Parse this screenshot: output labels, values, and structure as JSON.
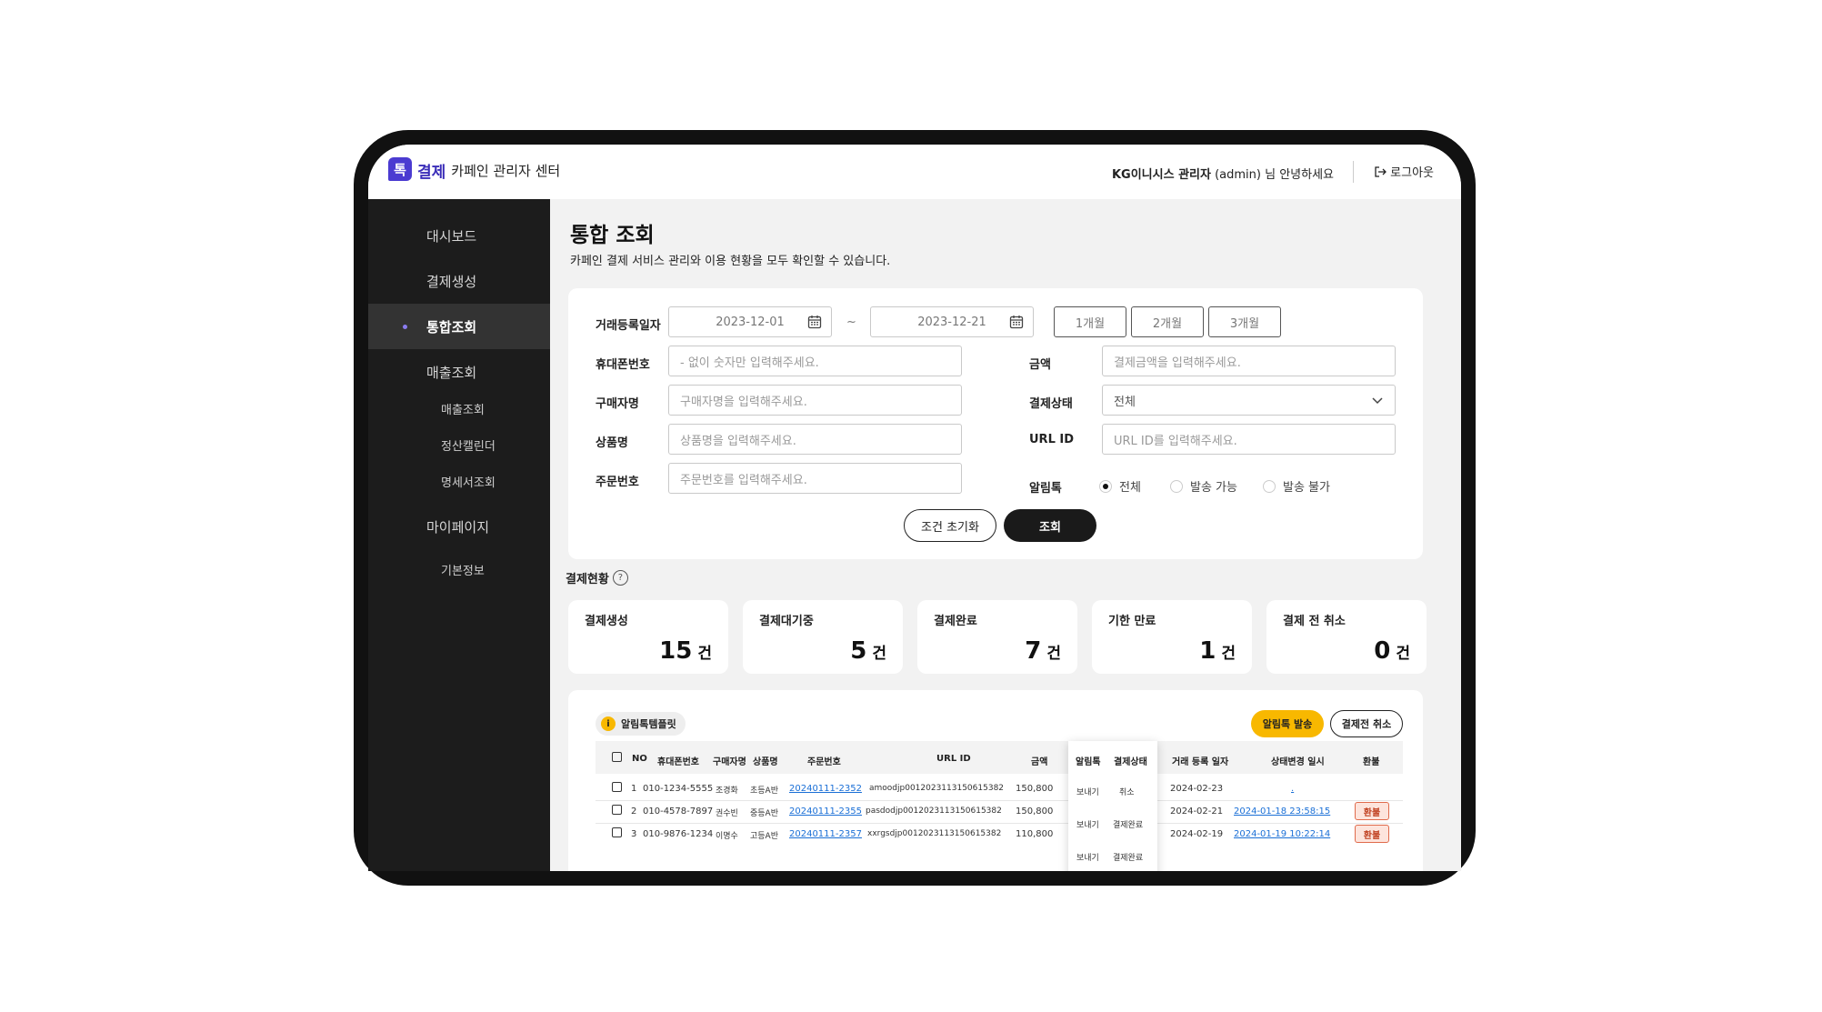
{
  "header": {
    "logo_mark": "톡",
    "logo_brand": "결제",
    "logo_sub": "카페인 관리자 센터",
    "greeting_user": "KG이니시스 관리자",
    "greeting_rest": "(admin) 님 안녕하세요",
    "logout": "로그아웃"
  },
  "sidebar": {
    "items": [
      {
        "label": "대시보드"
      },
      {
        "label": "결제생성"
      },
      {
        "label": "통합조회"
      },
      {
        "label": "매출조회"
      },
      {
        "label": "마이페이지"
      }
    ],
    "sub_sales": [
      "매출조회",
      "정산캘린더",
      "명세서조회"
    ],
    "sub_mypage": [
      "기본정보"
    ]
  },
  "page": {
    "title": "통합 조회",
    "desc": "카페인 결제 서비스 관리와 이용 현황을 모두 확인할 수 있습니다."
  },
  "search": {
    "date_label": "거래등록일자",
    "date_from": "2023-12-01",
    "date_tilde": "~",
    "date_to": "2023-12-21",
    "period_buttons": [
      "1개월",
      "2개월",
      "3개월"
    ],
    "phone_label": "휴대폰번호",
    "phone_placeholder": "- 없이 숫자만 입력해주세요.",
    "buyer_label": "구매자명",
    "buyer_placeholder": "구매자명을 입력해주세요.",
    "product_label": "상품명",
    "product_placeholder": "상품명을 입력해주세요.",
    "order_label": "주문번호",
    "order_placeholder": "주문번호를 입력해주세요.",
    "amount_label": "금액",
    "amount_placeholder": "결제금액을 입력해주세요.",
    "status_label": "결제상태",
    "status_value": "전체",
    "urlid_label": "URL ID",
    "urlid_placeholder": "URL ID를 입력해주세요.",
    "alimtalk_label": "알림톡",
    "alimtalk_options": [
      "전체",
      "발송 가능",
      "발송 불가"
    ],
    "reset_button": "조건 초기화",
    "search_button": "조회"
  },
  "status": {
    "title": "결제현황",
    "help": "?",
    "unit": "건",
    "cards": [
      {
        "label": "결제생성",
        "value": "15"
      },
      {
        "label": "결제대기중",
        "value": "5"
      },
      {
        "label": "결제완료",
        "value": "7"
      },
      {
        "label": "기한 만료",
        "value": "1"
      },
      {
        "label": "결제 전 취소",
        "value": "0"
      }
    ]
  },
  "list": {
    "template_badge": "알림톡템플릿",
    "template_icon": "i",
    "send_button": "알림톡 발송",
    "cancel_button": "결제전 취소",
    "columns": [
      "NO",
      "휴대폰번호",
      "구매자명",
      "상품명",
      "주문번호",
      "URL ID",
      "금액",
      "알림톡",
      "결제상태",
      "거래 등록 일자",
      "상태변경 일시",
      "환불"
    ],
    "rows": [
      {
        "no": "1",
        "phone": "010-1234-5555",
        "buyer": "조경화",
        "product": "초등A반",
        "order": "20240111-2352",
        "urlid": "amoodjp0012023113150615382",
        "amount": "150,800",
        "alimtalk": "보내기",
        "status": "취소",
        "date": "2024-02-23",
        "changed": ".",
        "refund": ""
      },
      {
        "no": "2",
        "phone": "010-4578-7897",
        "buyer": "권수빈",
        "product": "중등A반",
        "order": "20240111-2355",
        "urlid": "pasdodjp0012023113150615382",
        "amount": "150,800",
        "alimtalk": "보내기",
        "status": "결제완료",
        "date": "2024-02-21",
        "changed": "2024-01-18 23:58:15",
        "refund": "환불"
      },
      {
        "no": "3",
        "phone": "010-9876-1234",
        "buyer": "이명수",
        "product": "고등A반",
        "order": "20240111-2357",
        "urlid": "xxrgsdjp0012023113150615382",
        "amount": "110,800",
        "alimtalk": "보내기",
        "status": "결제완료",
        "date": "2024-02-19",
        "changed": "2024-01-19 10:22:14",
        "refund": "환불"
      }
    ]
  },
  "colors": {
    "sidebar_bg": "#1c1c1c",
    "accent_yellow": "#f8b800",
    "brand_purple": "#4b3bd1",
    "link_blue": "#1a6fd6",
    "refund_red": "#e06b4c"
  }
}
